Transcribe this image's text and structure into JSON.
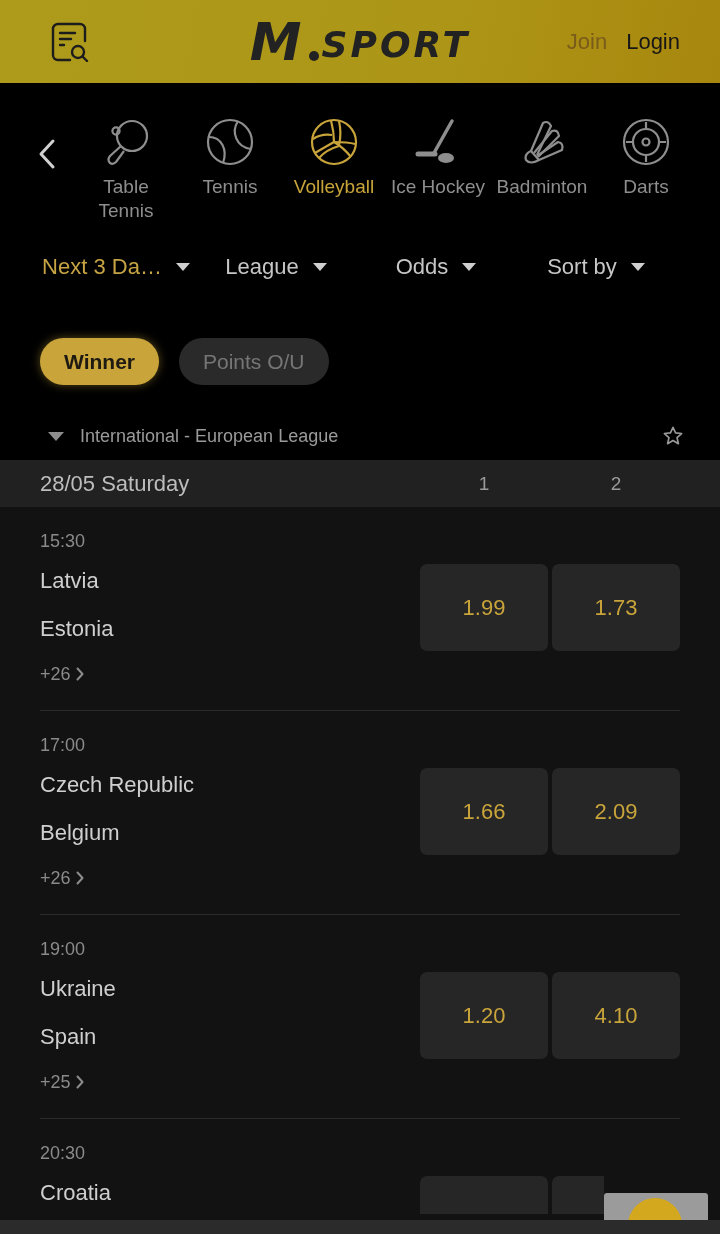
{
  "header": {
    "logo": {
      "mark": "M",
      "wordmark": "SPORT"
    },
    "join": "Join",
    "login": "Login"
  },
  "sports": [
    {
      "kind": "tabletennis",
      "label": "Table Tennis",
      "selected": false
    },
    {
      "kind": "tennis",
      "label": "Tennis",
      "selected": false
    },
    {
      "kind": "volleyball",
      "label": "Volleyball",
      "selected": true
    },
    {
      "kind": "hockey",
      "label": "Ice Hockey",
      "selected": false
    },
    {
      "kind": "badminton",
      "label": "Badminton",
      "selected": false
    },
    {
      "kind": "darts",
      "label": "Darts",
      "selected": false
    }
  ],
  "filters": [
    {
      "label": "Next 3 Da…",
      "active": true
    },
    {
      "label": "League",
      "active": false
    },
    {
      "label": "Odds",
      "active": false
    },
    {
      "label": "Sort by",
      "active": false
    }
  ],
  "markets": [
    {
      "label": "Winner",
      "selected": true
    },
    {
      "label": "Points O/U",
      "selected": false
    }
  ],
  "league": {
    "name": "International - European League",
    "expanded": true,
    "favorite": false
  },
  "date_header": {
    "date": "28/05 Saturday",
    "columns": [
      "1",
      "2"
    ]
  },
  "matches": [
    {
      "kind": "full",
      "time": "15:30",
      "teams": [
        "Latvia",
        "Estonia"
      ],
      "more": "+26",
      "odds": [
        "1.99",
        "1.73"
      ]
    },
    {
      "kind": "full",
      "time": "17:00",
      "teams": [
        "Czech Republic",
        "Belgium"
      ],
      "more": "+26",
      "odds": [
        "1.66",
        "2.09"
      ]
    },
    {
      "kind": "full",
      "time": "19:00",
      "teams": [
        "Ukraine",
        "Spain"
      ],
      "more": "+25",
      "odds": [
        "1.20",
        "4.10"
      ]
    },
    {
      "kind": "partial",
      "time": "20:30",
      "teams": [
        "Croatia"
      ]
    }
  ]
}
